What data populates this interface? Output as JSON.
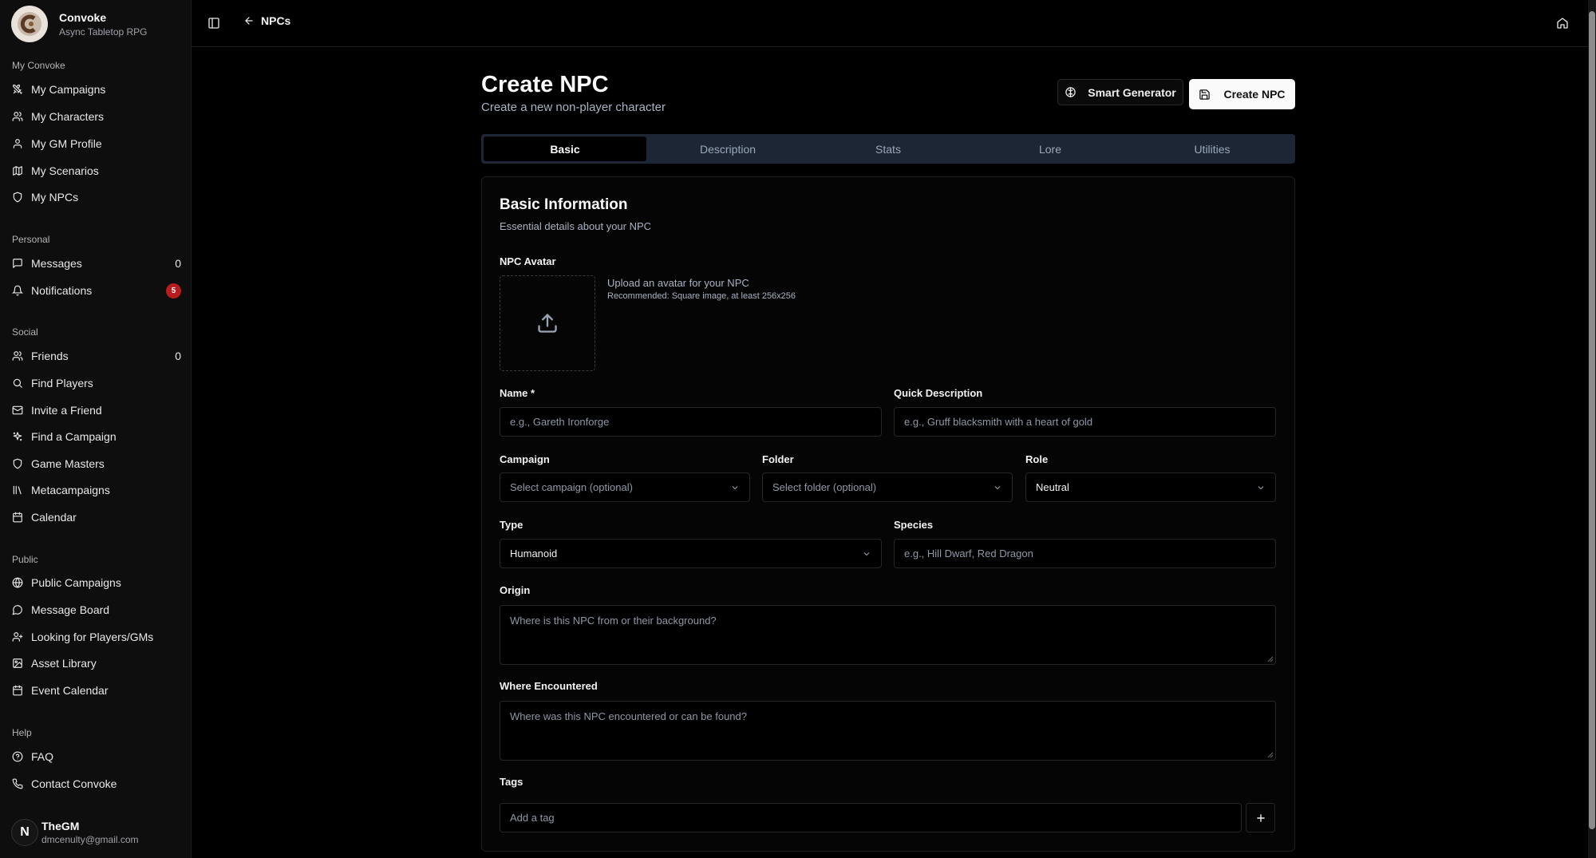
{
  "app": {
    "name": "Convoke",
    "tagline": "Async Tabletop RPG"
  },
  "sidebar": {
    "sections": [
      {
        "label": "My Convoke",
        "items": [
          {
            "label": "My Campaigns",
            "icon": "swords-icon"
          },
          {
            "label": "My Characters",
            "icon": "users-icon"
          },
          {
            "label": "My GM Profile",
            "icon": "user-icon"
          },
          {
            "label": "My Scenarios",
            "icon": "map-icon"
          },
          {
            "label": "My NPCs",
            "icon": "shield-icon"
          }
        ]
      },
      {
        "label": "Personal",
        "items": [
          {
            "label": "Messages",
            "icon": "message-icon",
            "count": "0"
          },
          {
            "label": "Notifications",
            "icon": "bell-icon",
            "badge": "5"
          }
        ]
      },
      {
        "label": "Social",
        "items": [
          {
            "label": "Friends",
            "icon": "users-icon",
            "count": "0"
          },
          {
            "label": "Find Players",
            "icon": "search-icon"
          },
          {
            "label": "Invite a Friend",
            "icon": "mail-icon"
          },
          {
            "label": "Find a Campaign",
            "icon": "sparkles-icon"
          },
          {
            "label": "Game Masters",
            "icon": "shield-icon"
          },
          {
            "label": "Metacampaigns",
            "icon": "library-icon"
          },
          {
            "label": "Calendar",
            "icon": "calendar-icon"
          }
        ]
      },
      {
        "label": "Public",
        "items": [
          {
            "label": "Public Campaigns",
            "icon": "globe-icon"
          },
          {
            "label": "Message Board",
            "icon": "message-circle-icon"
          },
          {
            "label": "Looking for Players/GMs",
            "icon": "user-plus-icon"
          },
          {
            "label": "Asset Library",
            "icon": "image-icon"
          },
          {
            "label": "Event Calendar",
            "icon": "calendar-icon"
          }
        ]
      },
      {
        "label": "Help",
        "items": [
          {
            "label": "FAQ",
            "icon": "help-circle-icon"
          },
          {
            "label": "Contact Convoke",
            "icon": "phone-icon"
          }
        ]
      }
    ],
    "user": {
      "initial": "N",
      "name": "TheGM",
      "email": "dmcenulty@gmail.com"
    }
  },
  "topbar": {
    "back_label": "NPCs"
  },
  "page": {
    "title": "Create NPC",
    "subtitle": "Create a new non-player character",
    "smart_generator_label": "Smart Generator",
    "create_label": "Create NPC",
    "tabs": [
      "Basic",
      "Description",
      "Stats",
      "Lore",
      "Utilities"
    ],
    "active_tab": "Basic"
  },
  "form": {
    "section_title": "Basic Information",
    "section_subtitle": "Essential details about your NPC",
    "avatar": {
      "label": "NPC Avatar",
      "hint": "Upload an avatar for your NPC",
      "recommendation": "Recommended: Square image, at least 256x256"
    },
    "name": {
      "label": "Name *",
      "placeholder": "e.g., Gareth Ironforge"
    },
    "quick_description": {
      "label": "Quick Description",
      "placeholder": "e.g., Gruff blacksmith with a heart of gold"
    },
    "campaign": {
      "label": "Campaign",
      "placeholder": "Select campaign (optional)"
    },
    "folder": {
      "label": "Folder",
      "placeholder": "Select folder (optional)"
    },
    "role": {
      "label": "Role",
      "value": "Neutral"
    },
    "type": {
      "label": "Type",
      "value": "Humanoid"
    },
    "species": {
      "label": "Species",
      "placeholder": "e.g., Hill Dwarf, Red Dragon"
    },
    "origin": {
      "label": "Origin",
      "placeholder": "Where is this NPC from or their background?"
    },
    "where_encountered": {
      "label": "Where Encountered",
      "placeholder": "Where was this NPC encountered or can be found?"
    },
    "tags": {
      "label": "Tags",
      "placeholder": "Add a tag"
    }
  },
  "colors": {
    "background": "#000000",
    "sidebar": "#0e0e0e",
    "tab_bar": "#1d2635",
    "muted_text": "#a8b3c4",
    "notification_badge": "#b91c1c"
  }
}
